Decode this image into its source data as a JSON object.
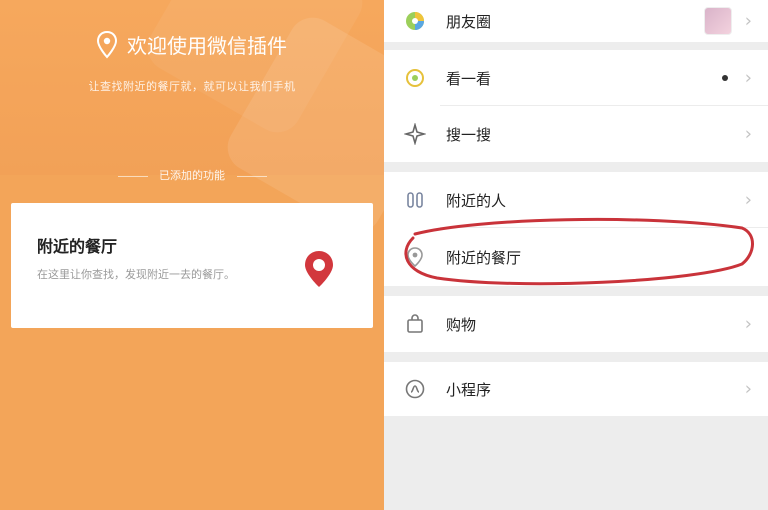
{
  "left": {
    "welcome": "欢迎使用微信插件",
    "subtitle": "让查找附近的餐厅就，就可以让我们手机",
    "section_title": "已添加的功能",
    "card": {
      "title": "附近的餐厅",
      "desc": "在这里让你查找，发现附近一去的餐厅。"
    }
  },
  "right": {
    "items": [
      {
        "label": "朋友圈",
        "icon": "moments-icon"
      },
      {
        "label": "看一看",
        "icon": "look-icon"
      },
      {
        "label": "搜一搜",
        "icon": "search-star-icon"
      },
      {
        "label": "附近的人",
        "icon": "nearby-people-icon"
      },
      {
        "label": "附近的餐厅",
        "icon": "restaurant-pin-icon"
      },
      {
        "label": "购物",
        "icon": "shopping-bag-icon"
      },
      {
        "label": "小程序",
        "icon": "mini-program-icon"
      }
    ]
  },
  "colors": {
    "left_bg": "#f3a559",
    "accent_red": "#d2373d",
    "highlight_red": "#c9333a"
  }
}
